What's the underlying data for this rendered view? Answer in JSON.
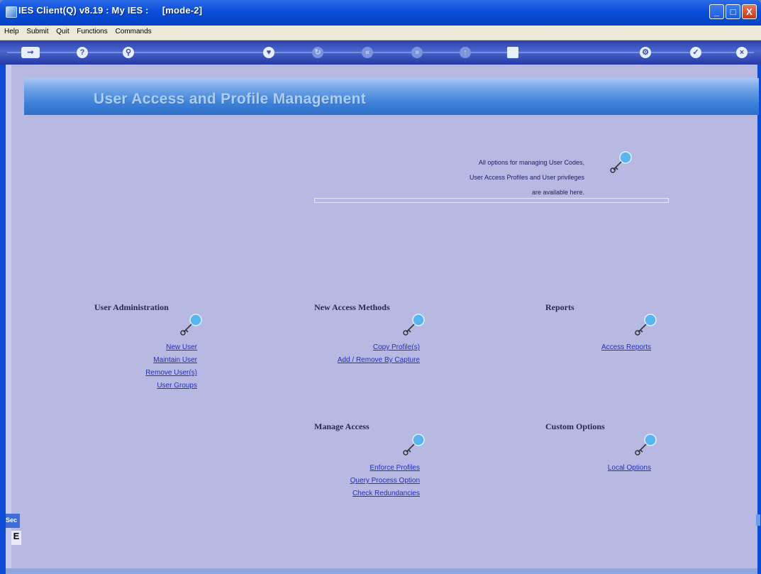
{
  "window": {
    "title": "IES Client(Q) v8.19 : My IES :     [mode-2]",
    "minimize": "_",
    "maximize": "□",
    "close": "X"
  },
  "menu": [
    "Help",
    "Submit",
    "Quit",
    "Functions",
    "Commands"
  ],
  "toolbar": {
    "icons": [
      "exit-icon",
      "help-icon",
      "search-icon",
      "favorite-icon",
      "refresh-icon",
      "back-icon",
      "forward-icon",
      "up-icon",
      "stop-icon",
      "settings-icon",
      "accept-icon",
      "cancel-icon"
    ]
  },
  "banner": {
    "title": "User Access and Profile Management"
  },
  "intro": {
    "line1": "All options for managing User Codes,",
    "line2": "User Access Profiles and User privileges",
    "line3": "are available here."
  },
  "sections": {
    "user_admin": {
      "title": "User Administration",
      "links": [
        "New User",
        "Maintain User",
        "Remove User(s)",
        "User Groups"
      ]
    },
    "new_access": {
      "title": "New Access Methods",
      "links": [
        "Copy Profile(s)",
        "Add / Remove By Capture"
      ]
    },
    "reports": {
      "title": "Reports",
      "links": [
        "Access Reports"
      ]
    },
    "manage_access": {
      "title": "Manage Access",
      "links": [
        "Enforce Profiles",
        "Query Process Option",
        "Check Redundancies"
      ]
    },
    "custom_options": {
      "title": "Custom Options",
      "links": [
        "Local Options"
      ]
    }
  },
  "sidebar_tab": {
    "label": "Sec",
    "box": "E"
  },
  "colors": {
    "background": "#b7b9e3",
    "link": "#1f2fc7",
    "titlebar": "#0a4dd9",
    "banner": "#3b80d8"
  }
}
